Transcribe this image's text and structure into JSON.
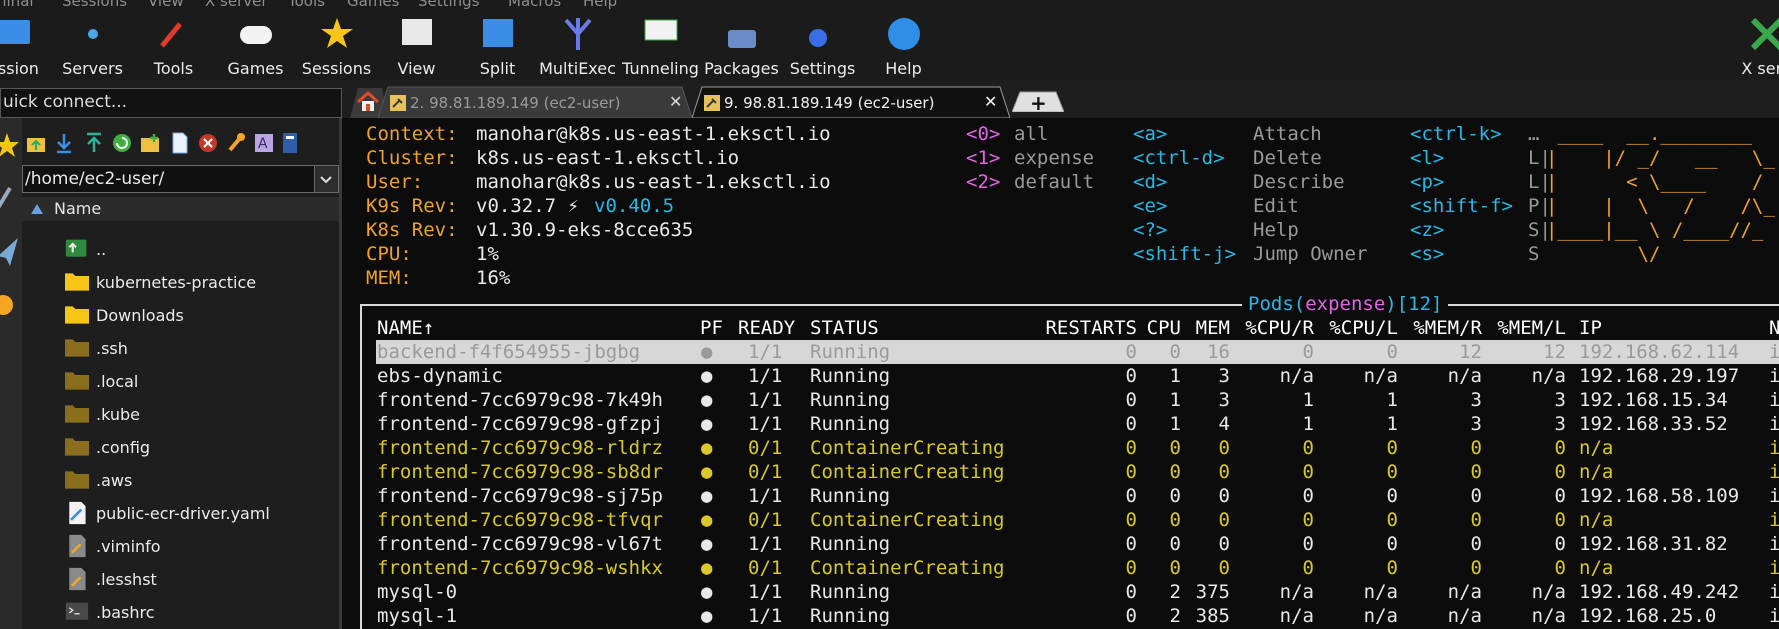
{
  "menu": [
    "rminal",
    "Sessions",
    "View",
    "X server",
    "Tools",
    "Games",
    "Settings",
    "Macros",
    "Help"
  ],
  "toolbar": [
    {
      "label": "ession",
      "icon": "session-icon"
    },
    {
      "label": "Servers",
      "icon": "servers-icon"
    },
    {
      "label": "Tools",
      "icon": "tools-icon"
    },
    {
      "label": "Games",
      "icon": "games-icon"
    },
    {
      "label": "Sessions",
      "icon": "sessions-star-icon"
    },
    {
      "label": "View",
      "icon": "view-icon"
    },
    {
      "label": "Split",
      "icon": "split-icon"
    },
    {
      "label": "MultiExec",
      "icon": "multiexec-icon"
    },
    {
      "label": "Tunneling",
      "icon": "tunneling-icon"
    },
    {
      "label": "Packages",
      "icon": "packages-icon"
    },
    {
      "label": "Settings",
      "icon": "settings-icon"
    },
    {
      "label": "Help",
      "icon": "help-icon"
    },
    {
      "label": "X serv",
      "icon": "x-server-icon"
    }
  ],
  "sidebar": {
    "quick_connect": "uick connect...",
    "path": "/home/ec2-user/",
    "column_header": "Name",
    "files": [
      {
        "name": "..",
        "type": "up"
      },
      {
        "name": "kubernetes-practice",
        "type": "folder"
      },
      {
        "name": "Downloads",
        "type": "folder"
      },
      {
        "name": ".ssh",
        "type": "hidden-folder"
      },
      {
        "name": ".local",
        "type": "hidden-folder"
      },
      {
        "name": ".kube",
        "type": "hidden-folder"
      },
      {
        "name": ".config",
        "type": "hidden-folder"
      },
      {
        "name": ".aws",
        "type": "hidden-folder"
      },
      {
        "name": "public-ecr-driver.yaml",
        "type": "yaml"
      },
      {
        "name": ".viminfo",
        "type": "file"
      },
      {
        "name": ".lesshst",
        "type": "file"
      },
      {
        "name": ".bashrc",
        "type": "terminal-file"
      }
    ]
  },
  "tabs": [
    {
      "label": "2. 98.81.189.149 (ec2-user)",
      "active": false
    },
    {
      "label": "9. 98.81.189.149 (ec2-user)",
      "active": true
    }
  ],
  "k9s": {
    "info": [
      {
        "key": "Context:",
        "value": "manohar@k8s.us-east-1.eksctl.io"
      },
      {
        "key": "Cluster:",
        "value": "k8s.us-east-1.eksctl.io"
      },
      {
        "key": "User:",
        "value": "manohar@k8s.us-east-1.eksctl.io"
      },
      {
        "key": "K9s Rev:",
        "value": "v0.32.7 ⚡ ",
        "extra": "v0.40.5"
      },
      {
        "key": "K8s Rev:",
        "value": "v1.30.9-eks-8cce635"
      },
      {
        "key": "CPU:",
        "value": "1%"
      },
      {
        "key": "MEM:",
        "value": "16%"
      }
    ],
    "namespaces": [
      {
        "key": "<0>",
        "label": "all"
      },
      {
        "key": "<1>",
        "label": "expense"
      },
      {
        "key": "<2>",
        "label": "default"
      }
    ],
    "shortcuts_a": [
      {
        "key": "<a>",
        "label": "Attach"
      },
      {
        "key": "<ctrl-d>",
        "label": "Delete"
      },
      {
        "key": "<d>",
        "label": "Describe"
      },
      {
        "key": "<e>",
        "label": "Edit"
      },
      {
        "key": "<?>",
        "label": "Help"
      },
      {
        "key": "<shift-j>",
        "label": "Jump Owner"
      }
    ],
    "shortcuts_b": [
      {
        "key": "<ctrl-k>",
        "label": "…"
      },
      {
        "key": "<l>",
        "label": "L|"
      },
      {
        "key": "<p>",
        "label": "L|"
      },
      {
        "key": "<shift-f>",
        "label": "P|"
      },
      {
        "key": "<z>",
        "label": "S|"
      },
      {
        "key": "<s>",
        "label": "S"
      }
    ],
    "logo": [
      " ____  __.________",
      "|    |/ _/   __   \\_",
      "|      < \\____    /",
      "|    |  \\   /    /\\_",
      "|____|__ \\ /____//_",
      "        \\/"
    ],
    "pods_title": {
      "prefix": "Pods(",
      "ns": "expense",
      "suffix": ")[12]"
    },
    "columns": [
      "NAME↑",
      "PF",
      "READY",
      "STATUS",
      "RESTARTS",
      "CPU",
      "MEM",
      "%CPU/R",
      "%CPU/L",
      "%MEM/R",
      "%MEM/L",
      "IP",
      "N"
    ],
    "rows": [
      {
        "name": "backend-f4f654955-jbgbg",
        "pf": "●",
        "ready": "1/1",
        "status": "Running",
        "restarts": "0",
        "cpu": "0",
        "mem": "16",
        "cpur": "0",
        "cpul": "0",
        "memr": "12",
        "meml": "12",
        "ip": "192.168.62.114",
        "n": "i",
        "state": "selected"
      },
      {
        "name": "ebs-dynamic",
        "pf": "●",
        "ready": "1/1",
        "status": "Running",
        "restarts": "0",
        "cpu": "1",
        "mem": "3",
        "cpur": "n/a",
        "cpul": "n/a",
        "memr": "n/a",
        "meml": "n/a",
        "ip": "192.168.29.197",
        "n": "i",
        "state": "ok"
      },
      {
        "name": "frontend-7cc6979c98-7k49h",
        "pf": "●",
        "ready": "1/1",
        "status": "Running",
        "restarts": "0",
        "cpu": "1",
        "mem": "3",
        "cpur": "1",
        "cpul": "1",
        "memr": "3",
        "meml": "3",
        "ip": "192.168.15.34",
        "n": "i",
        "state": "ok"
      },
      {
        "name": "frontend-7cc6979c98-gfzpj",
        "pf": "●",
        "ready": "1/1",
        "status": "Running",
        "restarts": "0",
        "cpu": "1",
        "mem": "4",
        "cpur": "1",
        "cpul": "1",
        "memr": "3",
        "meml": "3",
        "ip": "192.168.33.52",
        "n": "i",
        "state": "ok"
      },
      {
        "name": "frontend-7cc6979c98-rldrz",
        "pf": "●",
        "ready": "0/1",
        "status": "ContainerCreating",
        "restarts": "0",
        "cpu": "0",
        "mem": "0",
        "cpur": "0",
        "cpul": "0",
        "memr": "0",
        "meml": "0",
        "ip": "n/a",
        "n": "i",
        "state": "pending"
      },
      {
        "name": "frontend-7cc6979c98-sb8dr",
        "pf": "●",
        "ready": "0/1",
        "status": "ContainerCreating",
        "restarts": "0",
        "cpu": "0",
        "mem": "0",
        "cpur": "0",
        "cpul": "0",
        "memr": "0",
        "meml": "0",
        "ip": "n/a",
        "n": "i",
        "state": "pending"
      },
      {
        "name": "frontend-7cc6979c98-sj75p",
        "pf": "●",
        "ready": "1/1",
        "status": "Running",
        "restarts": "0",
        "cpu": "0",
        "mem": "0",
        "cpur": "0",
        "cpul": "0",
        "memr": "0",
        "meml": "0",
        "ip": "192.168.58.109",
        "n": "i",
        "state": "ok"
      },
      {
        "name": "frontend-7cc6979c98-tfvqr",
        "pf": "●",
        "ready": "0/1",
        "status": "ContainerCreating",
        "restarts": "0",
        "cpu": "0",
        "mem": "0",
        "cpur": "0",
        "cpul": "0",
        "memr": "0",
        "meml": "0",
        "ip": "n/a",
        "n": "i",
        "state": "pending"
      },
      {
        "name": "frontend-7cc6979c98-vl67t",
        "pf": "●",
        "ready": "1/1",
        "status": "Running",
        "restarts": "0",
        "cpu": "0",
        "mem": "0",
        "cpur": "0",
        "cpul": "0",
        "memr": "0",
        "meml": "0",
        "ip": "192.168.31.82",
        "n": "i",
        "state": "ok"
      },
      {
        "name": "frontend-7cc6979c98-wshkx",
        "pf": "●",
        "ready": "0/1",
        "status": "ContainerCreating",
        "restarts": "0",
        "cpu": "0",
        "mem": "0",
        "cpur": "0",
        "cpul": "0",
        "memr": "0",
        "meml": "0",
        "ip": "n/a",
        "n": "i",
        "state": "pending"
      },
      {
        "name": "mysql-0",
        "pf": "●",
        "ready": "1/1",
        "status": "Running",
        "restarts": "0",
        "cpu": "2",
        "mem": "375",
        "cpur": "n/a",
        "cpul": "n/a",
        "memr": "n/a",
        "meml": "n/a",
        "ip": "192.168.49.242",
        "n": "i",
        "state": "ok"
      },
      {
        "name": "mysql-1",
        "pf": "●",
        "ready": "1/1",
        "status": "Running",
        "restarts": "0",
        "cpu": "2",
        "mem": "385",
        "cpur": "n/a",
        "cpul": "n/a",
        "memr": "n/a",
        "meml": "n/a",
        "ip": "192.168.25.0",
        "n": "i",
        "state": "ok"
      }
    ]
  },
  "colors": {
    "terminal_bg": "#0c0c0c",
    "accent_orange": "#f0a030",
    "key_cyan": "#27b9e6",
    "namespace_magenta": "#e066e6",
    "pending_yellow": "#d8c82a",
    "running_white": "#e8e8e8",
    "selected_row_bg": "#d7d7d7"
  }
}
